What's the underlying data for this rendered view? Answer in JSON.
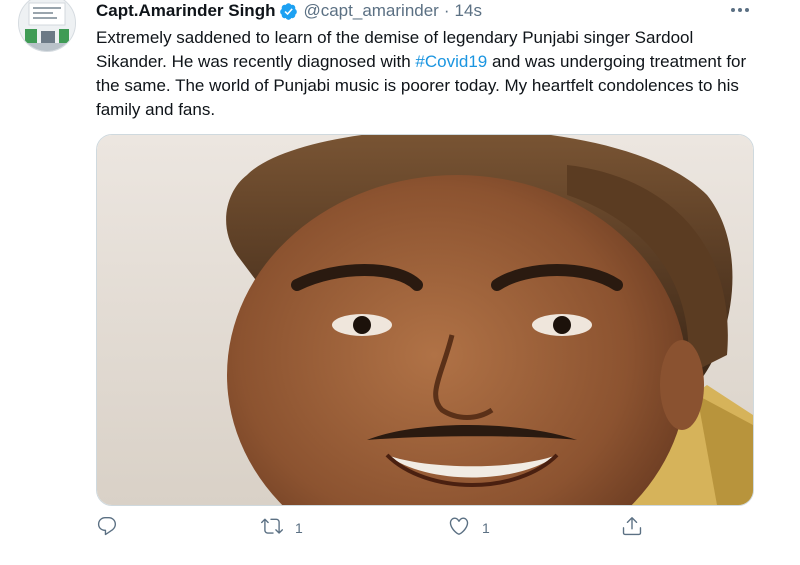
{
  "tweet": {
    "author_name": "Capt.Amarinder Singh",
    "handle": "@capt_amarinder",
    "separator": "·",
    "time": "14s",
    "text_before": "Extremely saddened to learn of the demise of legendary Punjabi singer Sardool Sikander. He was recently diagnosed with ",
    "hashtag": "#Covid19",
    "text_after": " and was undergoing treatment for the same. The world of Punjabi music is poorer today. My heartfelt condolences to his family and fans.",
    "media": {
      "alt": "Photo of singer Sardool Sikander"
    },
    "actions": {
      "reply_count": "",
      "retweet_count": "1",
      "like_count": "1"
    }
  },
  "colors": {
    "text": "#0f1419",
    "secondary": "#5b7083",
    "accent": "#1b95e0",
    "verified": "#1da1f2"
  },
  "icons": {
    "verified": "verified-badge-icon",
    "more": "more-options-icon",
    "reply": "reply-icon",
    "retweet": "retweet-icon",
    "like": "like-icon",
    "share": "share-icon"
  }
}
